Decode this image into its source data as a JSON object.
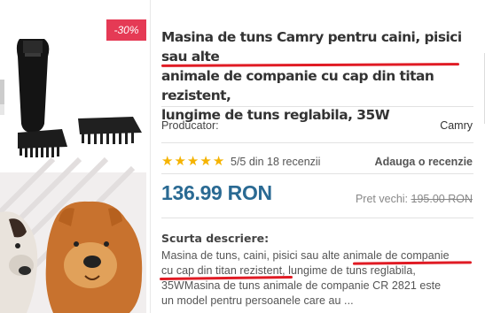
{
  "product": {
    "discount_badge": "-30%",
    "title_line1": "Masina de tuns Camry pentru caini, pisici sau alte",
    "title_line2": "animale de companie cu cap din titan rezistent,",
    "title_line3": "lungime de tuns reglabila, 35W",
    "producer_label": "Producator:",
    "producer_value": "Camry",
    "rating_text": "5/5 din 18 recenzii",
    "stars": 5,
    "add_review": "Adauga o recenzie",
    "price": "136.99 RON",
    "old_price_label": "Pret vechi:",
    "old_price_value": "195.00 RON",
    "desc_title": "Scurta descriere:",
    "desc_1": "Masina de tuns, caini, pisici sau alte ",
    "desc_2": "animale de companie",
    "desc_3": "cu cap din titan rezistent",
    "desc_4": ", lungime de tuns reglabila,",
    "desc_5": "35WMasina de tuns animale de companie CR 2821 este",
    "desc_6": "un model pentru persoanele care au ..."
  },
  "colors": {
    "price": "#2a6a93",
    "badge": "#e53a55",
    "stars": "#f5b301",
    "annotation": "#e01b24"
  },
  "icons": [
    "star-icon",
    "clipper-image",
    "dogs-image"
  ]
}
